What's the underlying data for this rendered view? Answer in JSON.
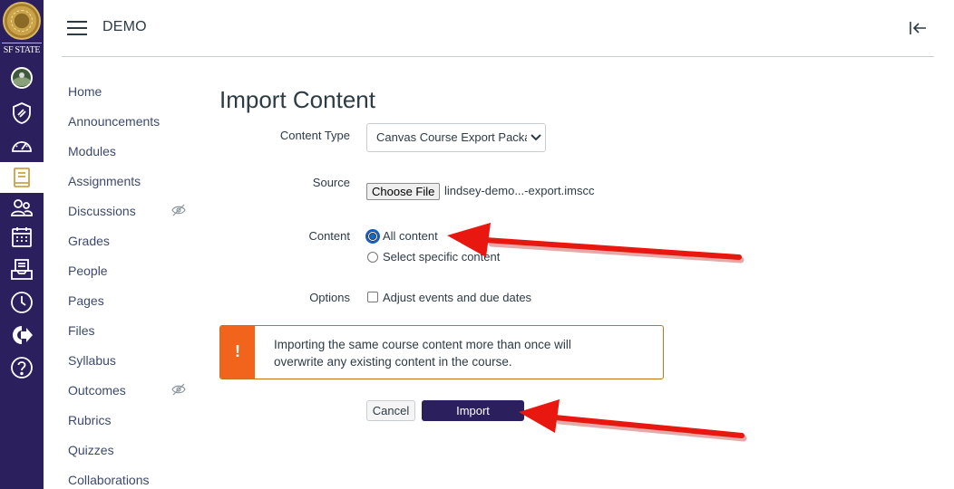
{
  "brand": {
    "wordmark": "SF STATE",
    "nav_bg": "#2c1f5e",
    "accent": "#2c1f5e"
  },
  "header": {
    "course_title": "DEMO",
    "menu_icon": "hamburger-icon",
    "collapse_icon": "collapse-left-icon"
  },
  "global_nav": {
    "items": [
      {
        "icon": "account-avatar-icon",
        "active": false
      },
      {
        "icon": "admin-shield-icon",
        "active": false
      },
      {
        "icon": "dashboard-gauge-icon",
        "active": false
      },
      {
        "icon": "courses-book-icon",
        "active": true
      },
      {
        "icon": "groups-people-icon",
        "active": false
      },
      {
        "icon": "calendar-icon",
        "active": false
      },
      {
        "icon": "inbox-icon",
        "active": false
      },
      {
        "icon": "history-clock-icon",
        "active": false
      },
      {
        "icon": "commons-arrow-icon",
        "active": false
      },
      {
        "icon": "help-question-icon",
        "active": false
      }
    ]
  },
  "course_nav": {
    "items": [
      {
        "label": "Home",
        "hidden": false
      },
      {
        "label": "Announcements",
        "hidden": false
      },
      {
        "label": "Modules",
        "hidden": false
      },
      {
        "label": "Assignments",
        "hidden": false
      },
      {
        "label": "Discussions",
        "hidden": true
      },
      {
        "label": "Grades",
        "hidden": false
      },
      {
        "label": "People",
        "hidden": false
      },
      {
        "label": "Pages",
        "hidden": false
      },
      {
        "label": "Files",
        "hidden": false
      },
      {
        "label": "Syllabus",
        "hidden": false
      },
      {
        "label": "Outcomes",
        "hidden": true
      },
      {
        "label": "Rubrics",
        "hidden": false
      },
      {
        "label": "Quizzes",
        "hidden": false
      },
      {
        "label": "Collaborations",
        "hidden": false
      }
    ]
  },
  "main": {
    "title": "Import Content",
    "content_type": {
      "label": "Content Type",
      "selected": "Canvas Course Export Package"
    },
    "source": {
      "label": "Source",
      "button": "Choose File",
      "file_name": "lindsey-demo...-export.imscc"
    },
    "content": {
      "label": "Content",
      "options": [
        {
          "label": "All content",
          "checked": true
        },
        {
          "label": "Select specific content",
          "checked": false
        }
      ]
    },
    "options": {
      "label": "Options",
      "checkbox_label": "Adjust events and due dates",
      "checked": false
    },
    "alert": {
      "icon": "!",
      "message": "Importing the same course content more than once will overwrite any existing content in the course.",
      "color": "#f2641c"
    },
    "buttons": {
      "cancel": "Cancel",
      "import": "Import"
    }
  },
  "annotations": {
    "arrow_color": "#e8170f"
  }
}
